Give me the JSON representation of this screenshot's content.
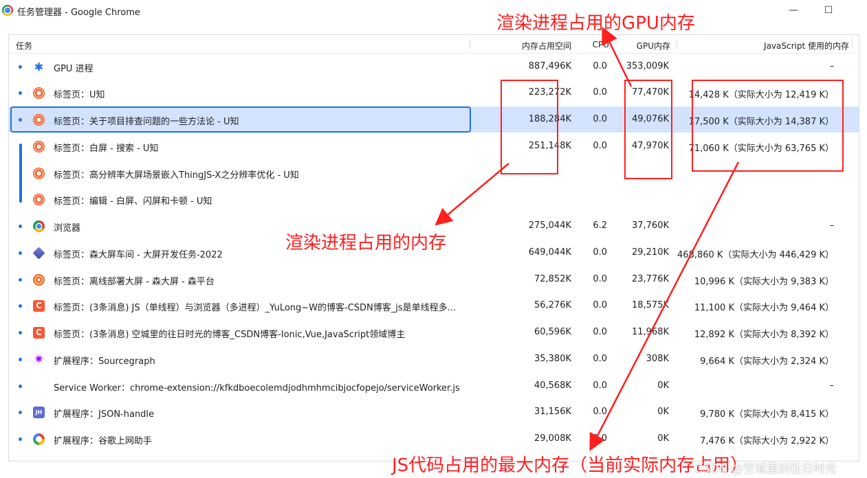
{
  "window": {
    "title": "任务管理器 - Google Chrome",
    "minimize": "—",
    "maximize": "☐"
  },
  "columns": {
    "task": "任务",
    "memory": "内存占用空间",
    "cpu": "CPU",
    "gpu": "GPU内存",
    "js": "JavaScript 使用的内存"
  },
  "rows": [
    {
      "name": "GPU 进程",
      "memory": "887,496K",
      "cpu": "0.0",
      "gpu": "353,009K",
      "js": "–",
      "icon": "puzzle-icon"
    },
    {
      "name": "标签页：U知",
      "memory": "223,272K",
      "cpu": "0.0",
      "gpu": "77,470K",
      "js": "14,428 K（实际大小为 12,419 K）",
      "icon": "uzhi-icon"
    },
    {
      "name": "标签页：关于项目排查问题的一些方法论 - U知",
      "memory": "188,284K",
      "cpu": "0.0",
      "gpu": "49,076K",
      "js": "17,500 K（实际大小为 14,387 K）",
      "icon": "uzhi-icon"
    },
    {
      "name": "标签页：白屏 - 搜索 - U知",
      "memory": "251,148K",
      "cpu": "0.0",
      "gpu": "47,970K",
      "js": "71,060 K（实际大小为 63,765 K）",
      "icon": "uzhi-icon"
    },
    {
      "name": "标签页：高分辨率大屏场景嵌入ThingJS-X之分辨率优化 - U知",
      "memory": "",
      "cpu": "",
      "gpu": "",
      "js": "",
      "icon": "uzhi-icon"
    },
    {
      "name": "标签页：编辑 - 白屏、闪屏和卡顿 - U知",
      "memory": "",
      "cpu": "",
      "gpu": "",
      "js": "",
      "icon": "uzhi-icon"
    },
    {
      "name": "浏览器",
      "memory": "275,044K",
      "cpu": "6.2",
      "gpu": "37,760K",
      "js": "–",
      "icon": "chrome-icon"
    },
    {
      "name": "标签页：森大屏车间 - 大屏开发任务-2022",
      "memory": "649,044K",
      "cpu": "0.0",
      "gpu": "29,210K",
      "js": "468,860 K（实际大小为 446,429 K）",
      "icon": "cube-icon"
    },
    {
      "name": "标签页：离线部署大屏 - 森大屏 - 森平台",
      "memory": "72,852K",
      "cpu": "0.0",
      "gpu": "23,776K",
      "js": "10,996 K（实际大小为 9,383 K）",
      "icon": "target-icon"
    },
    {
      "name": "标签页：(3条消息) JS（单线程）与浏览器（多进程）_YuLong~W的博客-CSDN博客_js是单线程多...",
      "memory": "56,276K",
      "cpu": "0.0",
      "gpu": "18,575K",
      "js": "11,100 K（实际大小为 9,464 K）",
      "icon": "csdn-icon"
    },
    {
      "name": "标签页：(3条消息) 空城里的往日时光的博客_CSDN博客-Ionic,Vue,JavaScript领域博主",
      "memory": "60,596K",
      "cpu": "0.0",
      "gpu": "11,968K",
      "js": "12,892 K（实际大小为 8,392 K）",
      "icon": "csdn-icon"
    },
    {
      "name": "扩展程序：Sourcegraph",
      "memory": "35,380K",
      "cpu": "0.0",
      "gpu": "308K",
      "js": "9,664 K（实际大小为 2,324 K）",
      "icon": "star-icon"
    },
    {
      "name": "Service Worker：chrome-extension://kfkdboecolemdjodhmhmcibjocfopejo/serviceWorker.js",
      "memory": "40,568K",
      "cpu": "0.0",
      "gpu": "0K",
      "js": "–",
      "icon": ""
    },
    {
      "name": "扩展程序：JSON-handle",
      "memory": "31,156K",
      "cpu": "0.0",
      "gpu": "0K",
      "js": "9,780 K（实际大小为 8,415 K）",
      "icon": "jh-icon"
    },
    {
      "name": "扩展程序：谷歌上网助手",
      "memory": "29,008K",
      "cpu": "0.0",
      "gpu": "0K",
      "js": "7,476 K（实际大小为 2,922 K）",
      "icon": "ring-icon"
    }
  ],
  "icon_glyphs": {
    "csdn": "C",
    "jh": "JH",
    "puzzle": "✱",
    "star": "✷"
  },
  "annotations": {
    "gpu": "渲染进程占用的GPU内存",
    "memory": "渲染进程占用的内存",
    "js": "JS代码占用的最大内存（当前实际内存占用）",
    "color": "#ff1f1f"
  },
  "watermark": "CSDN @空城里的往日时光",
  "colors": {
    "selected_row": "#d3e3fd",
    "accent": "#1a73e8"
  }
}
